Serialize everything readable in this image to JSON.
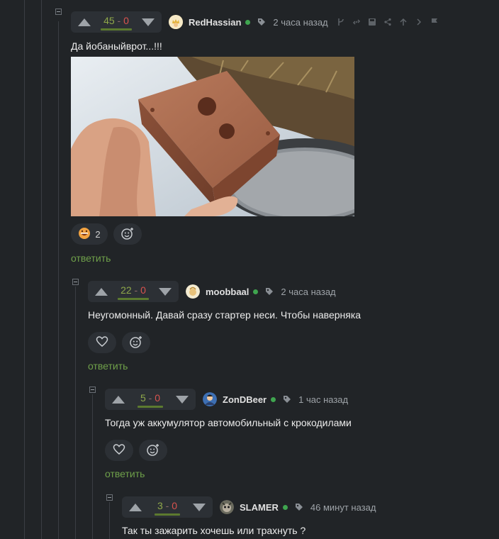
{
  "comments": [
    {
      "votes_plus": "45",
      "votes_minus": "0",
      "username": "RedHassian",
      "time": "2 часа назад",
      "text": "Да йобаныйврот...!!!",
      "reactions": [
        {
          "icon": "grin-emoji-icon",
          "count": "2"
        }
      ],
      "reply_label": "ответить"
    },
    {
      "votes_plus": "22",
      "votes_minus": "0",
      "username": "moobbaal",
      "time": "2 часа назад",
      "text": "Неугомонный. Давай сразу стартер неси. Чтобы наверняка",
      "reply_label": "ответить"
    },
    {
      "votes_plus": "5",
      "votes_minus": "0",
      "username": "ZonDBeer",
      "time": "1 час назад",
      "text": "Тогда уж аккумулятор автомобильный с крокодилами",
      "reply_label": "ответить"
    },
    {
      "votes_plus": "3",
      "votes_minus": "0",
      "username": "SLAMER",
      "time": "46 минут назад",
      "text": "Так ты зажарить хочешь или трахнуть ?"
    }
  ],
  "separator": "-",
  "colors": {
    "background": "#212427",
    "panel": "#2c3035",
    "plus": "#8fa84a",
    "minus": "#d9534f",
    "reply": "#6fa04a",
    "online": "#3fa54f"
  }
}
